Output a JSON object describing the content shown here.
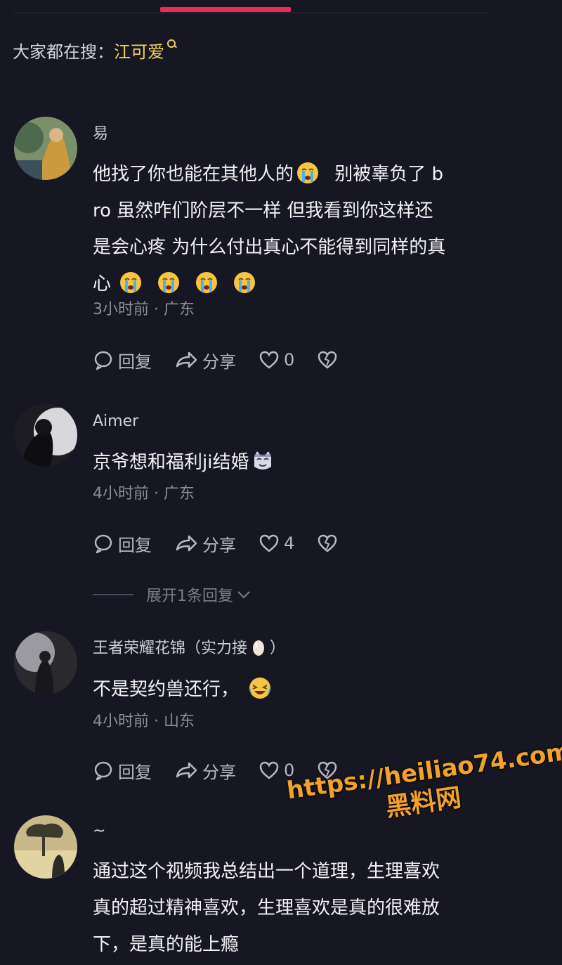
{
  "hot_search": {
    "prefix": "大家都在搜：",
    "keyword": "江可爱"
  },
  "comments": [
    {
      "username": "易",
      "lines": [
        "他找了你也能在其他人的",
        "别被辜负了 b",
        "ro 虽然咋们阶层不一样 但我看到你这样还",
        "是会心疼 为什么付出真心不能得到同样的真",
        "心"
      ],
      "time": "3小时前 · 广东",
      "reply": "回复",
      "share": "分享",
      "likes": "0"
    },
    {
      "username": "Aimer",
      "lines": [
        "京爷想和福利ji结婚"
      ],
      "time": "4小时前 · 广东",
      "reply": "回复",
      "share": "分享",
      "likes": "4"
    },
    {
      "username": "王者荣耀花锦（实力接",
      "username_end": "）",
      "lines": [
        "不是契约兽还行，"
      ],
      "time": "4小时前 · 山东",
      "reply": "回复",
      "share": "分享",
      "likes": "0"
    },
    {
      "username": "~",
      "lines": [
        "通过这个视频我总结出一个道理，生理喜欢",
        "真的超过精神喜欢，生理喜欢是真的很难放",
        "下，是真的能上瘾"
      ]
    }
  ],
  "expand_replies": "展开1条回复",
  "watermark": {
    "url": "https://heiliao74.com",
    "name": "黑料网"
  },
  "colors": {
    "accent": "#ee2a56",
    "keyword": "#f2d25c",
    "watermark": "#f2a22a",
    "background": "#161722"
  }
}
